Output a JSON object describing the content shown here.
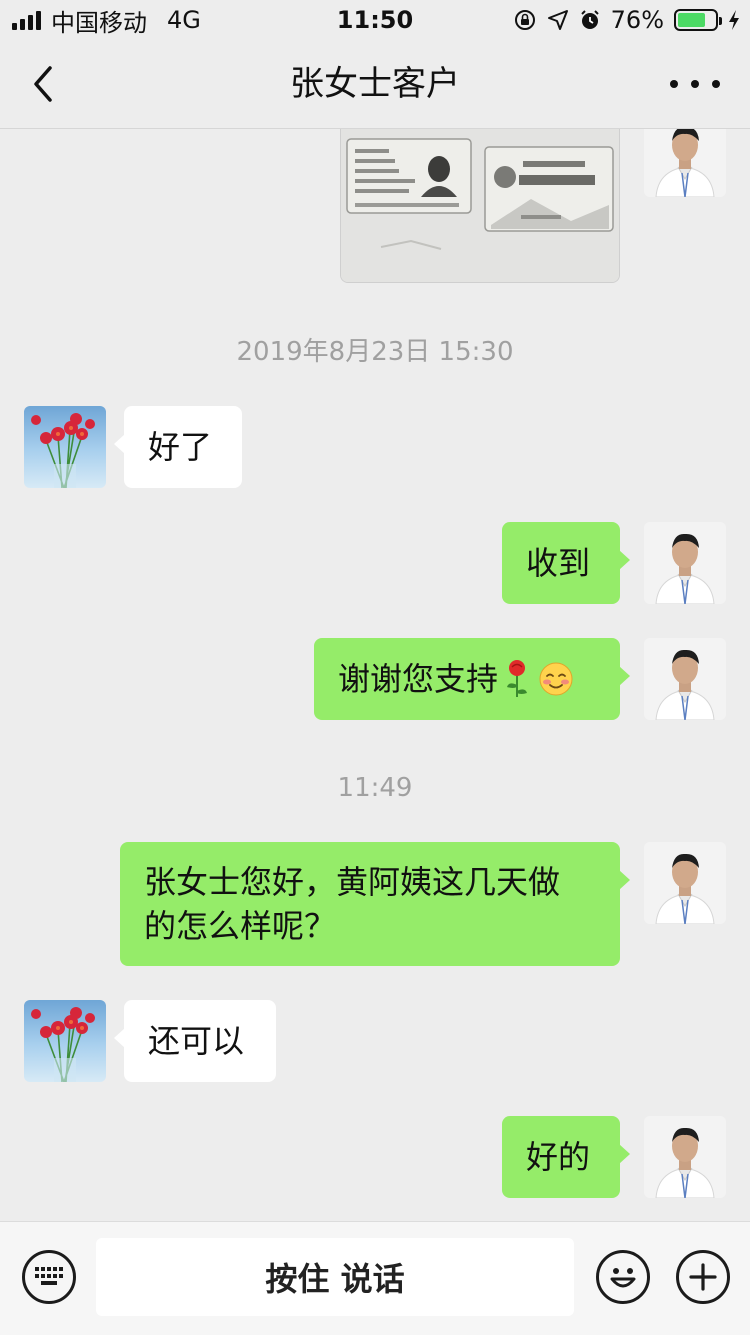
{
  "status_bar": {
    "carrier": "中国移动",
    "network": "4G",
    "time": "11:50",
    "battery_percent": "76%",
    "battery_level": 0.76,
    "icons": [
      "signal-icon",
      "rotation-lock-icon",
      "location-icon",
      "alarm-icon",
      "battery-icon",
      "charging-icon"
    ]
  },
  "nav": {
    "title": "张女士客户",
    "back_icon": "chevron-left-icon",
    "more_icon": "more-dots-icon"
  },
  "messages": [
    {
      "type": "image",
      "sender": "me"
    },
    {
      "type": "time",
      "text": "2019年8月23日 15:30"
    },
    {
      "type": "text",
      "sender": "other",
      "text": "好了"
    },
    {
      "type": "text",
      "sender": "me",
      "text": "收到"
    },
    {
      "type": "text",
      "sender": "me",
      "text": "谢谢您支持",
      "emoji": [
        "rose-emoji",
        "blush-emoji"
      ]
    },
    {
      "type": "time",
      "text": "11:49"
    },
    {
      "type": "text",
      "sender": "me",
      "lines": [
        "张女士您好，黄阿姨这几天做",
        "的怎么样呢？"
      ]
    },
    {
      "type": "text",
      "sender": "other",
      "text": "还可以"
    },
    {
      "type": "text",
      "sender": "me",
      "text": "好的"
    }
  ],
  "bottom_bar": {
    "hold_to_talk": "按住 说话",
    "icons": [
      "keyboard-icon",
      "emoji-icon",
      "plus-icon"
    ]
  },
  "colors": {
    "background": "#ededed",
    "sent_bubble": "#95ec69",
    "received_bubble": "#ffffff",
    "battery_fill": "#4cd964"
  }
}
